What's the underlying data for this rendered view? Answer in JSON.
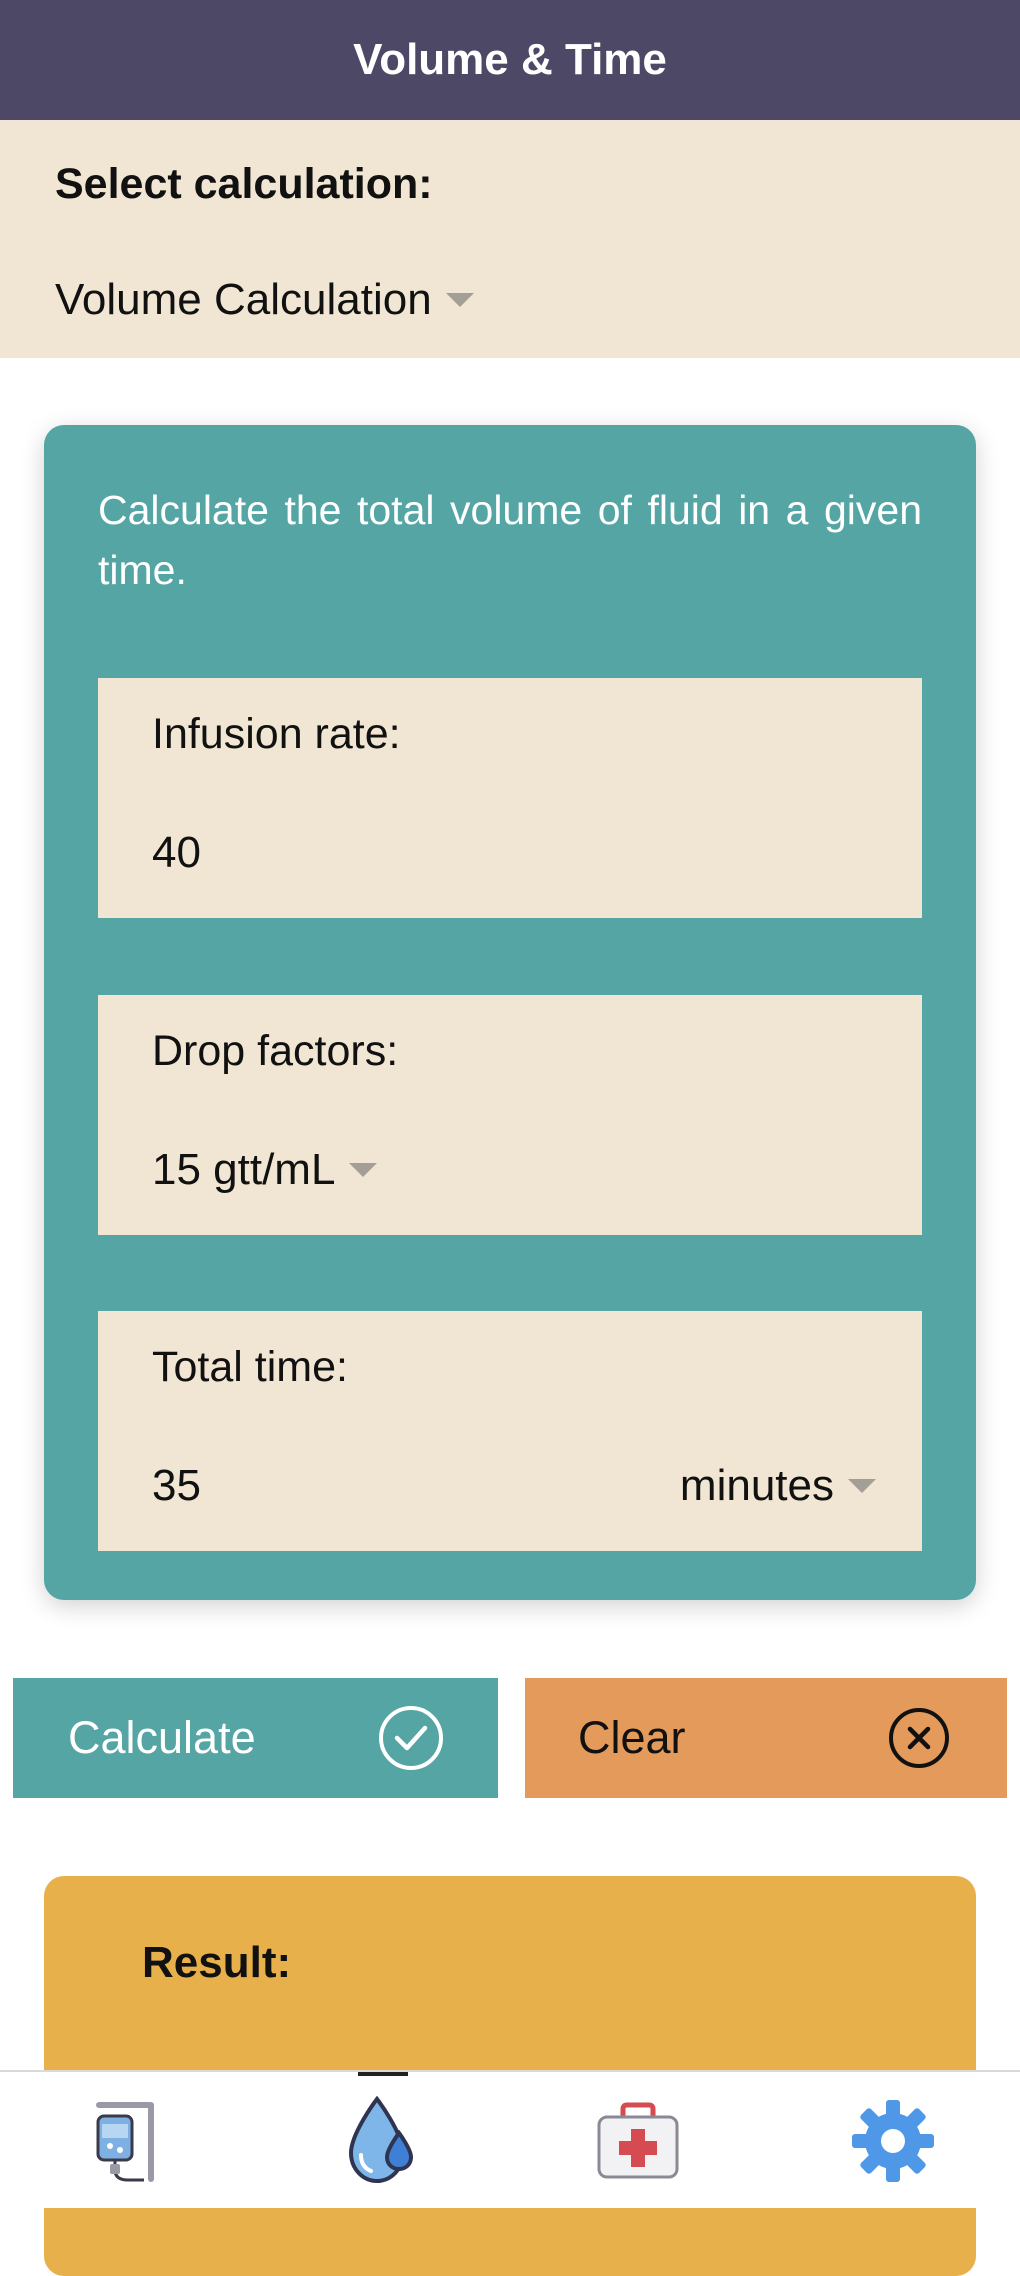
{
  "header": {
    "title": "Volume & Time"
  },
  "selector": {
    "label": "Select calculation:",
    "value": "Volume Calculation"
  },
  "card": {
    "description": "Calculate the total volume of fluid in a given time.",
    "infusion_rate": {
      "label": "Infusion rate:",
      "value": "40"
    },
    "drop_factors": {
      "label": "Drop factors:",
      "value": "15 gtt/mL"
    },
    "total_time": {
      "label": "Total time:",
      "value": "35",
      "unit": "minutes"
    }
  },
  "actions": {
    "calculate_label": "Calculate",
    "clear_label": "Clear"
  },
  "result": {
    "label": "Result:"
  },
  "nav": {
    "items": [
      {
        "icon": "iv-drip-icon",
        "active": false
      },
      {
        "icon": "water-drops-icon",
        "active": true
      },
      {
        "icon": "first-aid-kit-icon",
        "active": false
      },
      {
        "icon": "gear-icon",
        "active": false
      }
    ]
  },
  "colors": {
    "header": "#4d4866",
    "panel": "#f0e6d3",
    "card": "#55a5a5",
    "clear": "#e39a5a",
    "result": "#e8b04a"
  }
}
